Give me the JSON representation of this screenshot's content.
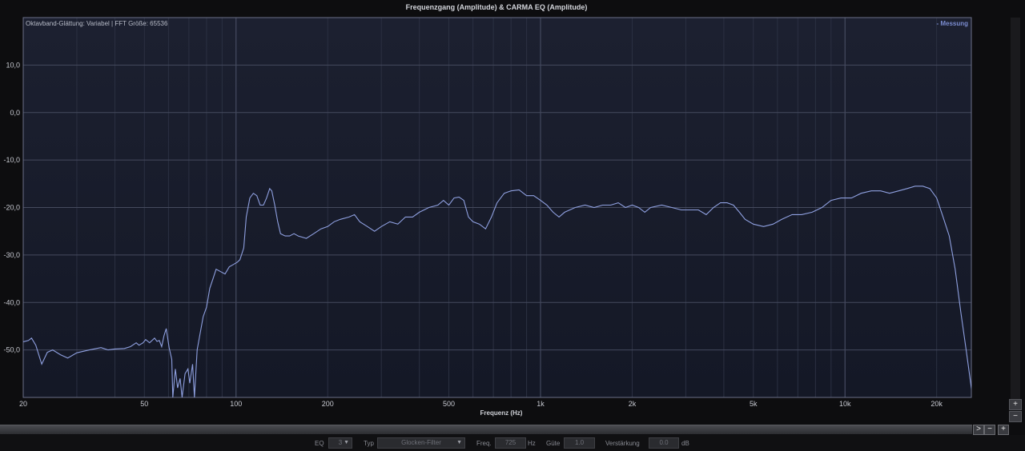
{
  "chart_data": {
    "type": "line",
    "title": "Frequenzgang (Amplitude) & CARMA EQ (Amplitude)",
    "info": "Oktavband-Glättung: Variabel | FFT Größe: 65536",
    "xlabel": "Frequenz (Hz)",
    "ylabel": "",
    "xscale": "log",
    "xlim": [
      20,
      26000
    ],
    "ylim": [
      -60,
      20
    ],
    "x_ticks": [
      20,
      50,
      100,
      200,
      500,
      1000,
      2000,
      5000,
      10000,
      20000
    ],
    "x_tick_labels": [
      "20",
      "50",
      "100",
      "200",
      "500",
      "1k",
      "2k",
      "5k",
      "10k",
      "20k"
    ],
    "y_ticks": [
      10,
      0,
      -10,
      -20,
      -30,
      -40,
      -50
    ],
    "y_tick_labels": [
      "10,0",
      "0,0",
      "-10,0",
      "-20,0",
      "-30,0",
      "-40,0",
      "-50,0"
    ],
    "grid": true,
    "legend_position": "top-right",
    "series": [
      {
        "name": "Messung",
        "color": "#8fa0e0",
        "points": [
          [
            20,
            -48.3
          ],
          [
            20.8,
            -48
          ],
          [
            21.3,
            -47.5
          ],
          [
            22,
            -49
          ],
          [
            23,
            -53
          ],
          [
            24,
            -50.5
          ],
          [
            25,
            -50
          ],
          [
            26.5,
            -51
          ],
          [
            28,
            -51.7
          ],
          [
            30,
            -50.6
          ],
          [
            33,
            -50
          ],
          [
            36,
            -49.5
          ],
          [
            38,
            -50
          ],
          [
            40,
            -49.8
          ],
          [
            43,
            -49.7
          ],
          [
            45,
            -49.3
          ],
          [
            47,
            -48.5
          ],
          [
            48,
            -49
          ],
          [
            49.5,
            -48.5
          ],
          [
            50.5,
            -47.8
          ],
          [
            52,
            -48.5
          ],
          [
            54,
            -47.5
          ],
          [
            55,
            -48.2
          ],
          [
            56,
            -48
          ],
          [
            57,
            -49.3
          ],
          [
            58,
            -47
          ],
          [
            59,
            -45.5
          ],
          [
            60.3,
            -49.5
          ],
          [
            61.5,
            -52
          ],
          [
            62,
            -60
          ],
          [
            63.2,
            -54
          ],
          [
            64.3,
            -58
          ],
          [
            65.5,
            -56
          ],
          [
            66.5,
            -60
          ],
          [
            68,
            -55
          ],
          [
            69.5,
            -54
          ],
          [
            70.5,
            -57
          ],
          [
            72,
            -53
          ],
          [
            73,
            -60
          ],
          [
            74.5,
            -50
          ],
          [
            76,
            -47
          ],
          [
            78,
            -43
          ],
          [
            80,
            -41
          ],
          [
            82,
            -37
          ],
          [
            84,
            -35
          ],
          [
            86,
            -33
          ],
          [
            89,
            -33.5
          ],
          [
            92,
            -34
          ],
          [
            95,
            -32.5
          ],
          [
            98,
            -32
          ],
          [
            101,
            -31.5
          ],
          [
            103,
            -31
          ],
          [
            106,
            -28.5
          ],
          [
            108,
            -22
          ],
          [
            111,
            -18
          ],
          [
            114,
            -17
          ],
          [
            117,
            -17.5
          ],
          [
            120,
            -19.5
          ],
          [
            123,
            -19.5
          ],
          [
            126,
            -18
          ],
          [
            129,
            -16
          ],
          [
            131,
            -16.5
          ],
          [
            134,
            -19.5
          ],
          [
            137,
            -23
          ],
          [
            140,
            -25.5
          ],
          [
            145,
            -26
          ],
          [
            150,
            -26
          ],
          [
            155,
            -25.5
          ],
          [
            160,
            -26
          ],
          [
            170,
            -26.5
          ],
          [
            180,
            -25.5
          ],
          [
            190,
            -24.5
          ],
          [
            200,
            -24
          ],
          [
            210,
            -23
          ],
          [
            220,
            -22.5
          ],
          [
            235,
            -22
          ],
          [
            245,
            -21.5
          ],
          [
            255,
            -23
          ],
          [
            270,
            -24
          ],
          [
            285,
            -25
          ],
          [
            300,
            -24
          ],
          [
            320,
            -23
          ],
          [
            340,
            -23.5
          ],
          [
            360,
            -22
          ],
          [
            380,
            -22
          ],
          [
            400,
            -21
          ],
          [
            430,
            -20
          ],
          [
            460,
            -19.5
          ],
          [
            480,
            -18.5
          ],
          [
            500,
            -19.5
          ],
          [
            520,
            -18
          ],
          [
            540,
            -17.8
          ],
          [
            560,
            -18.5
          ],
          [
            580,
            -22
          ],
          [
            600,
            -23
          ],
          [
            630,
            -23.5
          ],
          [
            660,
            -24.5
          ],
          [
            690,
            -22
          ],
          [
            720,
            -19
          ],
          [
            760,
            -17
          ],
          [
            800,
            -16.5
          ],
          [
            850,
            -16.3
          ],
          [
            900,
            -17.5
          ],
          [
            950,
            -17.5
          ],
          [
            1000,
            -18.5
          ],
          [
            1050,
            -19.5
          ],
          [
            1100,
            -21
          ],
          [
            1150,
            -22
          ],
          [
            1200,
            -21
          ],
          [
            1300,
            -20
          ],
          [
            1400,
            -19.5
          ],
          [
            1500,
            -20
          ],
          [
            1600,
            -19.5
          ],
          [
            1700,
            -19.5
          ],
          [
            1800,
            -19
          ],
          [
            1900,
            -20
          ],
          [
            2000,
            -19.5
          ],
          [
            2100,
            -20
          ],
          [
            2200,
            -21
          ],
          [
            2300,
            -20
          ],
          [
            2500,
            -19.5
          ],
          [
            2700,
            -20
          ],
          [
            2900,
            -20.5
          ],
          [
            3100,
            -20.5
          ],
          [
            3300,
            -20.5
          ],
          [
            3500,
            -21.5
          ],
          [
            3700,
            -20
          ],
          [
            3900,
            -19
          ],
          [
            4100,
            -19
          ],
          [
            4300,
            -19.5
          ],
          [
            4500,
            -21
          ],
          [
            4700,
            -22.5
          ],
          [
            5000,
            -23.5
          ],
          [
            5400,
            -24
          ],
          [
            5800,
            -23.5
          ],
          [
            6200,
            -22.5
          ],
          [
            6700,
            -21.5
          ],
          [
            7200,
            -21.5
          ],
          [
            7800,
            -21
          ],
          [
            8400,
            -20
          ],
          [
            9000,
            -18.5
          ],
          [
            9700,
            -18
          ],
          [
            10500,
            -18
          ],
          [
            11300,
            -17
          ],
          [
            12200,
            -16.5
          ],
          [
            13100,
            -16.5
          ],
          [
            14000,
            -17
          ],
          [
            15000,
            -16.5
          ],
          [
            16000,
            -16
          ],
          [
            17000,
            -15.5
          ],
          [
            18000,
            -15.5
          ],
          [
            19000,
            -16
          ],
          [
            20000,
            -18
          ],
          [
            21000,
            -22
          ],
          [
            22000,
            -26
          ],
          [
            23000,
            -33
          ],
          [
            24000,
            -42
          ],
          [
            25000,
            -50
          ],
          [
            26000,
            -58
          ],
          [
            26500,
            -60
          ]
        ]
      }
    ]
  },
  "eq_bar": {
    "eq_label": "EQ",
    "eq_value": "3",
    "type_label": "Typ",
    "type_value": "Glocken-Filter",
    "freq_label": "Freq.",
    "freq_value": "725",
    "freq_unit": "Hz",
    "q_label": "Güte",
    "q_value": "1.0",
    "gain_label": "Verstärkung",
    "gain_value": "0.0",
    "gain_unit": "dB"
  },
  "controls": {
    "scroll_right": ">",
    "minus": "−",
    "plus": "+",
    "v_plus": "+",
    "v_minus": "−"
  }
}
